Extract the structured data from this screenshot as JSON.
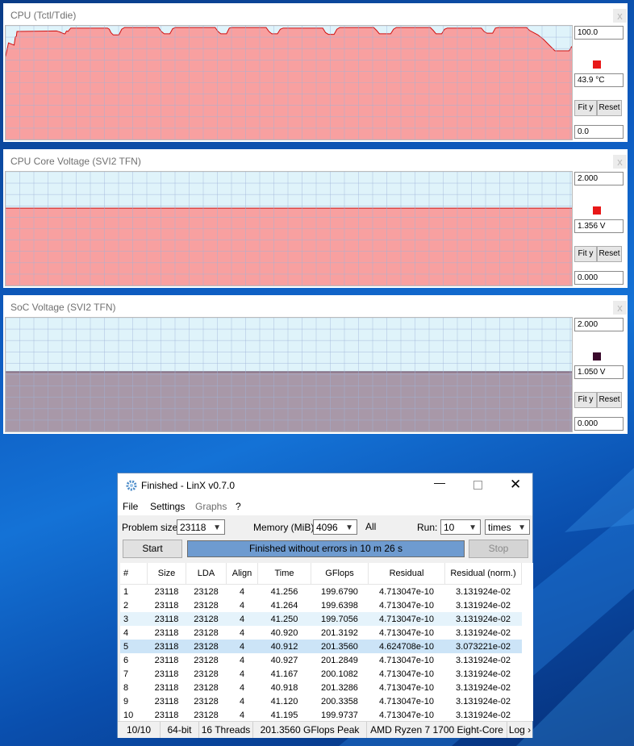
{
  "panels": [
    {
      "title": "CPU (Tctl/Tdie)",
      "max": "100.0",
      "value": "43.9 °C",
      "min": "0.0",
      "swatch": "#e81818",
      "fit": "Fit y",
      "reset": "Reset",
      "close": "x",
      "fill": "#f8a0a0",
      "line": "#d01010",
      "series": [
        [
          0,
          27
        ],
        [
          0.5,
          15
        ],
        [
          1.5,
          17
        ],
        [
          1.7,
          10
        ],
        [
          1.9,
          9
        ],
        [
          2,
          5
        ],
        [
          9,
          4.5
        ],
        [
          9.3,
          5
        ],
        [
          9.6,
          5.5
        ],
        [
          10.3,
          7
        ],
        [
          10.5,
          7
        ],
        [
          10.7,
          5
        ],
        [
          10.8,
          4.5
        ],
        [
          11,
          5
        ],
        [
          11.5,
          2
        ],
        [
          18,
          2
        ],
        [
          18.3,
          3
        ],
        [
          18.6,
          6
        ],
        [
          19,
          8
        ],
        [
          20,
          8
        ],
        [
          20.5,
          3
        ],
        [
          21,
          1.5
        ],
        [
          27,
          1.5
        ],
        [
          27.5,
          5
        ],
        [
          28,
          7
        ],
        [
          29,
          7
        ],
        [
          29.5,
          2.5
        ],
        [
          30,
          1.5
        ],
        [
          37,
          1.5
        ],
        [
          37.5,
          5
        ],
        [
          38,
          7
        ],
        [
          39,
          7
        ],
        [
          39.5,
          2
        ],
        [
          40,
          1.5
        ],
        [
          46,
          1.5
        ],
        [
          46.5,
          5
        ],
        [
          47,
          7
        ],
        [
          48,
          7
        ],
        [
          48.5,
          3
        ],
        [
          49,
          2
        ],
        [
          56,
          2
        ],
        [
          56.5,
          6
        ],
        [
          57,
          7.5
        ],
        [
          58,
          7.5
        ],
        [
          58.5,
          3
        ],
        [
          59,
          1.5
        ],
        [
          65,
          1.5
        ],
        [
          65.5,
          4
        ],
        [
          66,
          7
        ],
        [
          68,
          7
        ],
        [
          68.5,
          3
        ],
        [
          69,
          1.5
        ],
        [
          75,
          1.5
        ],
        [
          75.5,
          4
        ],
        [
          76,
          7
        ],
        [
          77,
          7
        ],
        [
          77.5,
          3
        ],
        [
          78,
          2
        ],
        [
          84,
          2
        ],
        [
          84.5,
          5
        ],
        [
          85,
          6.5
        ],
        [
          86,
          6.5
        ],
        [
          86.5,
          2
        ],
        [
          87,
          1.5
        ],
        [
          92,
          1.5
        ],
        [
          92.5,
          4
        ],
        [
          94,
          8
        ],
        [
          95,
          12
        ],
        [
          96,
          17
        ],
        [
          97,
          22
        ],
        [
          98,
          22
        ],
        [
          99.5,
          22
        ],
        [
          100,
          18
        ]
      ]
    },
    {
      "title": "CPU Core Voltage (SVI2 TFN)",
      "max": "2.000",
      "value": "1.356 V",
      "min": "0.000",
      "swatch": "#e81818",
      "fit": "Fit y",
      "reset": "Reset",
      "close": "x",
      "fill": "#f8a0a0",
      "line": "#d01010",
      "series": [
        [
          0,
          32
        ],
        [
          100,
          32
        ]
      ]
    },
    {
      "title": "SoC Voltage (SVI2 TFN)",
      "max": "2.000",
      "value": "1.050 V",
      "min": "0.000",
      "swatch": "#3a0a2c",
      "fit": "Fit y",
      "reset": "Reset",
      "close": "x",
      "fill": "#a898a8",
      "line": "#5a3a56",
      "series": [
        [
          0,
          47.5
        ],
        [
          100,
          47.5
        ]
      ]
    }
  ],
  "linx": {
    "title": "Finished - LinX v0.7.0",
    "menu": [
      "File",
      "Settings",
      "Graphs",
      "?"
    ],
    "problem_size_label": "Problem size:",
    "problem_size": "23118",
    "memory_label": "Memory (MiB):",
    "memory": "4096",
    "all": "All",
    "run_label": "Run:",
    "runs": "10",
    "times": "times",
    "start": "Start",
    "stop": "Stop",
    "progress_text": "Finished without errors in 10 m 26 s",
    "progress": 1.0,
    "columns": [
      "#",
      "Size",
      "LDA",
      "Align",
      "Time",
      "GFlops",
      "Residual",
      "Residual (norm.)"
    ],
    "rows": [
      [
        "1",
        "23118",
        "23128",
        "4",
        "41.256",
        "199.6790",
        "4.713047e-10",
        "3.131924e-02"
      ],
      [
        "2",
        "23118",
        "23128",
        "4",
        "41.264",
        "199.6398",
        "4.713047e-10",
        "3.131924e-02"
      ],
      [
        "3",
        "23118",
        "23128",
        "4",
        "41.250",
        "199.7056",
        "4.713047e-10",
        "3.131924e-02"
      ],
      [
        "4",
        "23118",
        "23128",
        "4",
        "40.920",
        "201.3192",
        "4.713047e-10",
        "3.131924e-02"
      ],
      [
        "5",
        "23118",
        "23128",
        "4",
        "40.912",
        "201.3560",
        "4.624708e-10",
        "3.073221e-02"
      ],
      [
        "6",
        "23118",
        "23128",
        "4",
        "40.927",
        "201.2849",
        "4.713047e-10",
        "3.131924e-02"
      ],
      [
        "7",
        "23118",
        "23128",
        "4",
        "41.167",
        "200.1082",
        "4.713047e-10",
        "3.131924e-02"
      ],
      [
        "8",
        "23118",
        "23128",
        "4",
        "40.918",
        "201.3286",
        "4.713047e-10",
        "3.131924e-02"
      ],
      [
        "9",
        "23118",
        "23128",
        "4",
        "41.120",
        "200.3358",
        "4.713047e-10",
        "3.131924e-02"
      ],
      [
        "10",
        "23118",
        "23128",
        "4",
        "41.195",
        "199.9737",
        "4.713047e-10",
        "3.131924e-02"
      ]
    ],
    "selected_row": 4,
    "hover_row": 2,
    "status": [
      "10/10",
      "64-bit",
      "16 Threads",
      "201.3560 GFlops Peak",
      "AMD Ryzen 7 1700 Eight-Core",
      "Log ›"
    ]
  }
}
